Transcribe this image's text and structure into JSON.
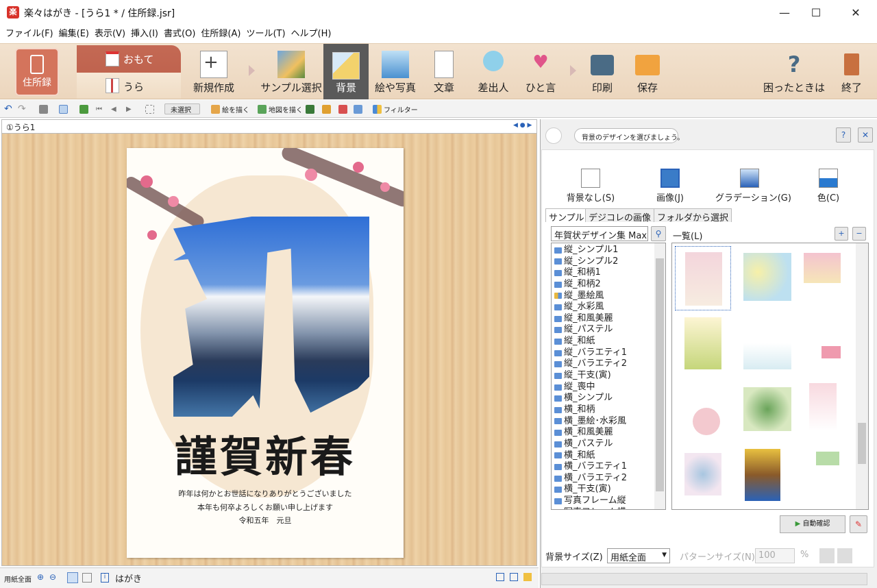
{
  "window": {
    "title": "楽々はがき - [うら1 * / 住所録.jsr]",
    "app_icon_glyph": "楽",
    "minimize": "—",
    "maximize": "☐",
    "close": "✕"
  },
  "menu": [
    "ファイル(F)",
    "編集(E)",
    "表示(V)",
    "挿入(I)",
    "書式(O)",
    "住所録(A)",
    "ツール(T)",
    "ヘルプ(H)"
  ],
  "ribbon": {
    "address_book": "住所録",
    "omote": "おもて",
    "ura": "うら",
    "new": "新規作成",
    "sample": "サンプル選択",
    "background": "背景",
    "picture": "絵や写真",
    "text": "文章",
    "sender": "差出人",
    "note": "ひと言",
    "print": "印刷",
    "save": "保存",
    "help": "困ったときは",
    "exit": "終了"
  },
  "toolbar2": {
    "unselected": "未選択",
    "draw": "絵を描く",
    "map": "地図を描く",
    "filter": "フィルター"
  },
  "editor": {
    "tab_label": "①うら1",
    "greeting": "謹賀新春",
    "message_lines": [
      "昨年は何かとお世話になりありがとうございました",
      "本年も何卒よろしくお願い申し上げます",
      "令和五年　元旦"
    ]
  },
  "statusbar": {
    "paper_full": "用紙全面",
    "card_type": "はがき"
  },
  "panel": {
    "hint": "背景のデザインを選びましょう。",
    "help_icon": "?",
    "close_icon": "✕",
    "bg_types": [
      "背景なし(S)",
      "画像(J)",
      "グラデーション(G)",
      "色(C)"
    ],
    "subtabs": [
      "サンプル",
      "デジコレの画像",
      "フォルダから選択"
    ],
    "search_value": "年賀状デザイン集 Max",
    "list_label": "一覧(L)",
    "folders": [
      "縦_シンプル1",
      "縦_シンプル2",
      "縦_和柄1",
      "縦_和柄2",
      "縦_墨絵風",
      "縦_水彩風",
      "縦_和風美麗",
      "縦_パステル",
      "縦_和紙",
      "縦_バラエティ1",
      "縦_バラエティ2",
      "縦_干支(寅)",
      "縦_喪中",
      "横_シンプル",
      "横_和柄",
      "横_墨絵･水彩風",
      "横_和風美麗",
      "横_パステル",
      "横_和紙",
      "横_バラエティ1",
      "横_バラエティ2",
      "横_干支(寅)",
      "写真フレーム縦",
      "写真フレーム横"
    ],
    "auto_confirm": "自動確認",
    "bg_size_label": "背景サイズ(Z)",
    "bg_size_value": "用紙全面",
    "pattern_size_label": "パターンサイズ(N)",
    "pattern_size_value": "100",
    "percent": "%"
  }
}
